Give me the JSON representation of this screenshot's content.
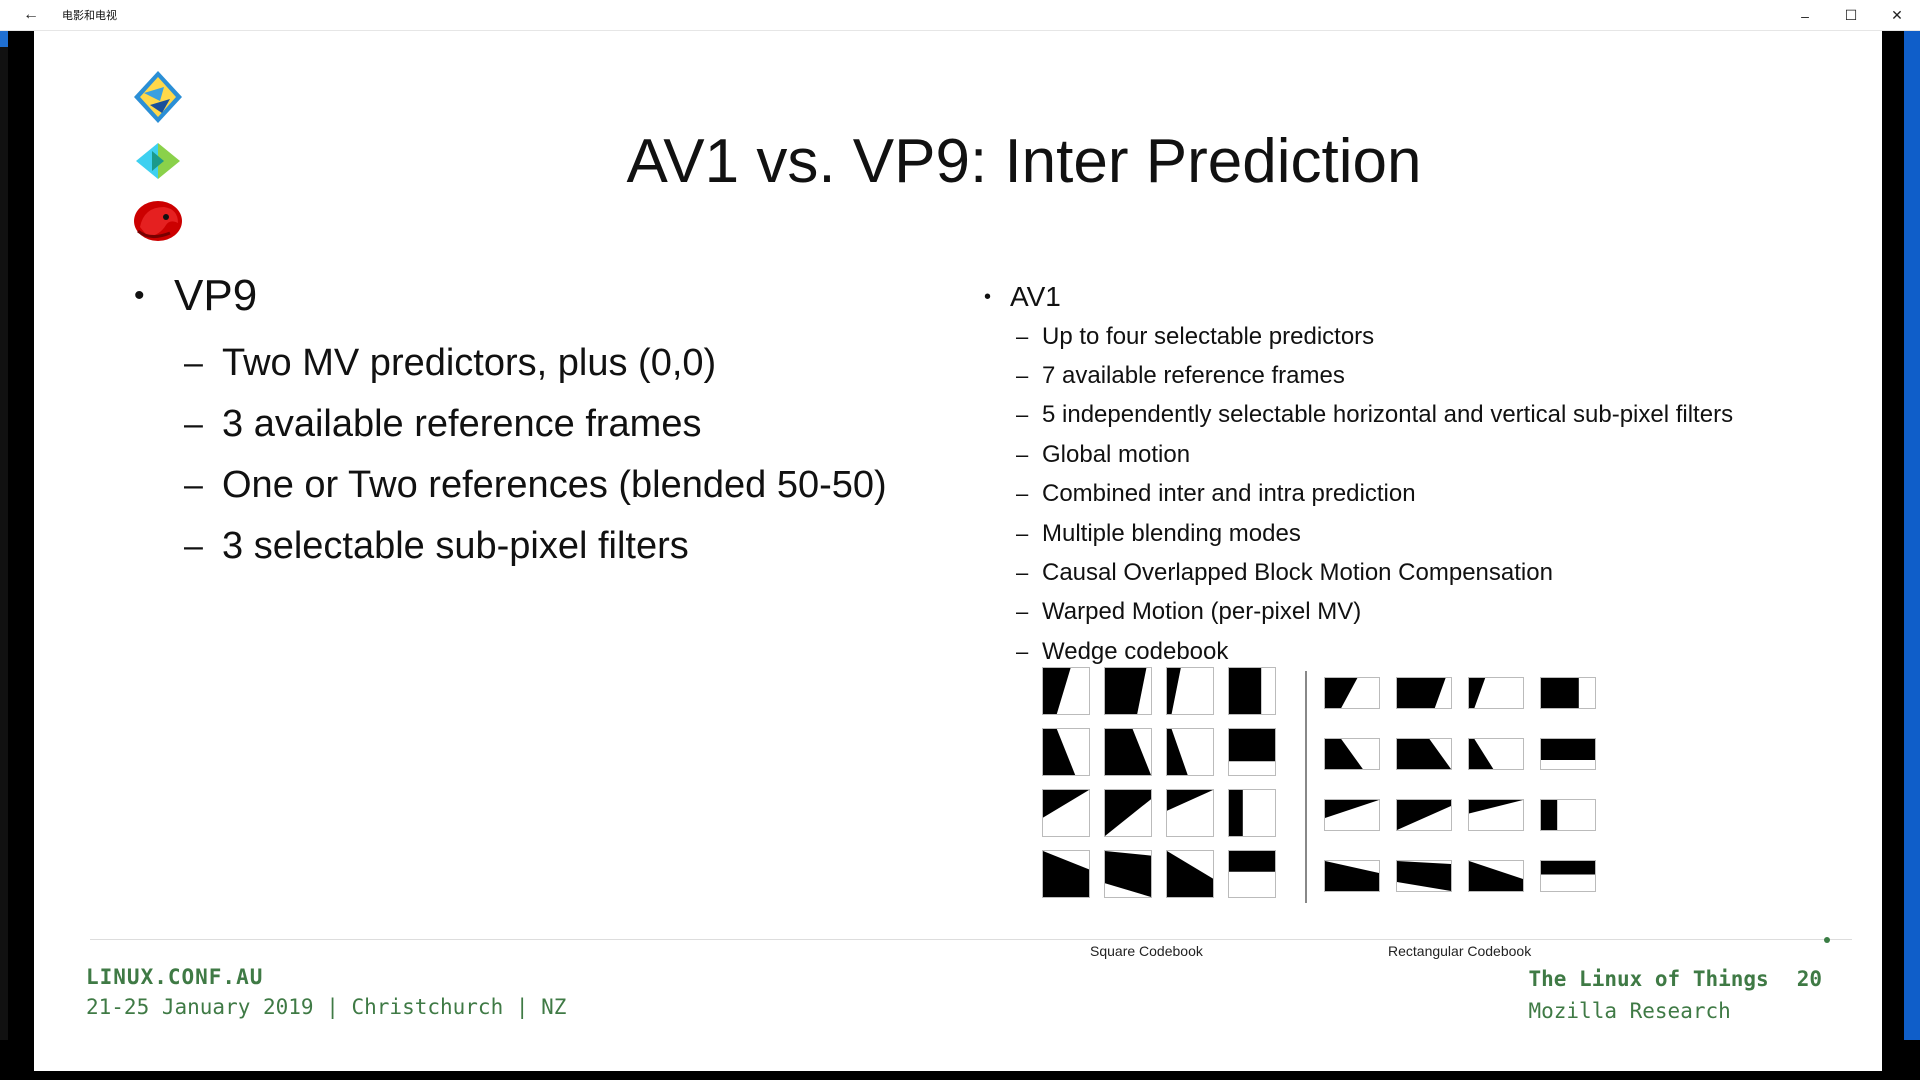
{
  "window": {
    "title": "电影和电视",
    "back_icon": "←",
    "minimize_icon": "–",
    "maximize_icon": "☐",
    "close_icon": "✕"
  },
  "slide": {
    "title": "AV1 vs. VP9: Inter Prediction",
    "logos": [
      "av1-logo-icon",
      "vp9-logo-icon",
      "mozilla-logo-icon"
    ],
    "vp9": {
      "heading": "VP9",
      "items": [
        "Two MV predictors, plus (0,0)",
        "3 available reference frames",
        "One or Two references (blended 50-50)",
        "3 selectable sub-pixel filters"
      ]
    },
    "av1": {
      "heading": "AV1",
      "items": [
        "Up to four selectable predictors",
        "7 available reference frames",
        "5 independently selectable horizontal and vertical sub-pixel filters",
        "Global motion",
        "Combined inter and intra prediction",
        "Multiple blending modes",
        "Causal Overlapped Block Motion Compensation",
        "Warped Motion (per-pixel MV)",
        "Wedge codebook"
      ]
    },
    "codebook": {
      "square_label": "Square Codebook",
      "rect_label": "Rectangular Codebook"
    },
    "footer": {
      "conf": "LINUX.CONF.AU",
      "dates": "21-25 January 2019 | Christchurch | NZ",
      "talk": "The Linux of Things",
      "page": "20",
      "org": "Mozilla Research"
    }
  },
  "colors": {
    "footer_green": "#3f7a45",
    "accent_blue": "#0f5ec9"
  }
}
